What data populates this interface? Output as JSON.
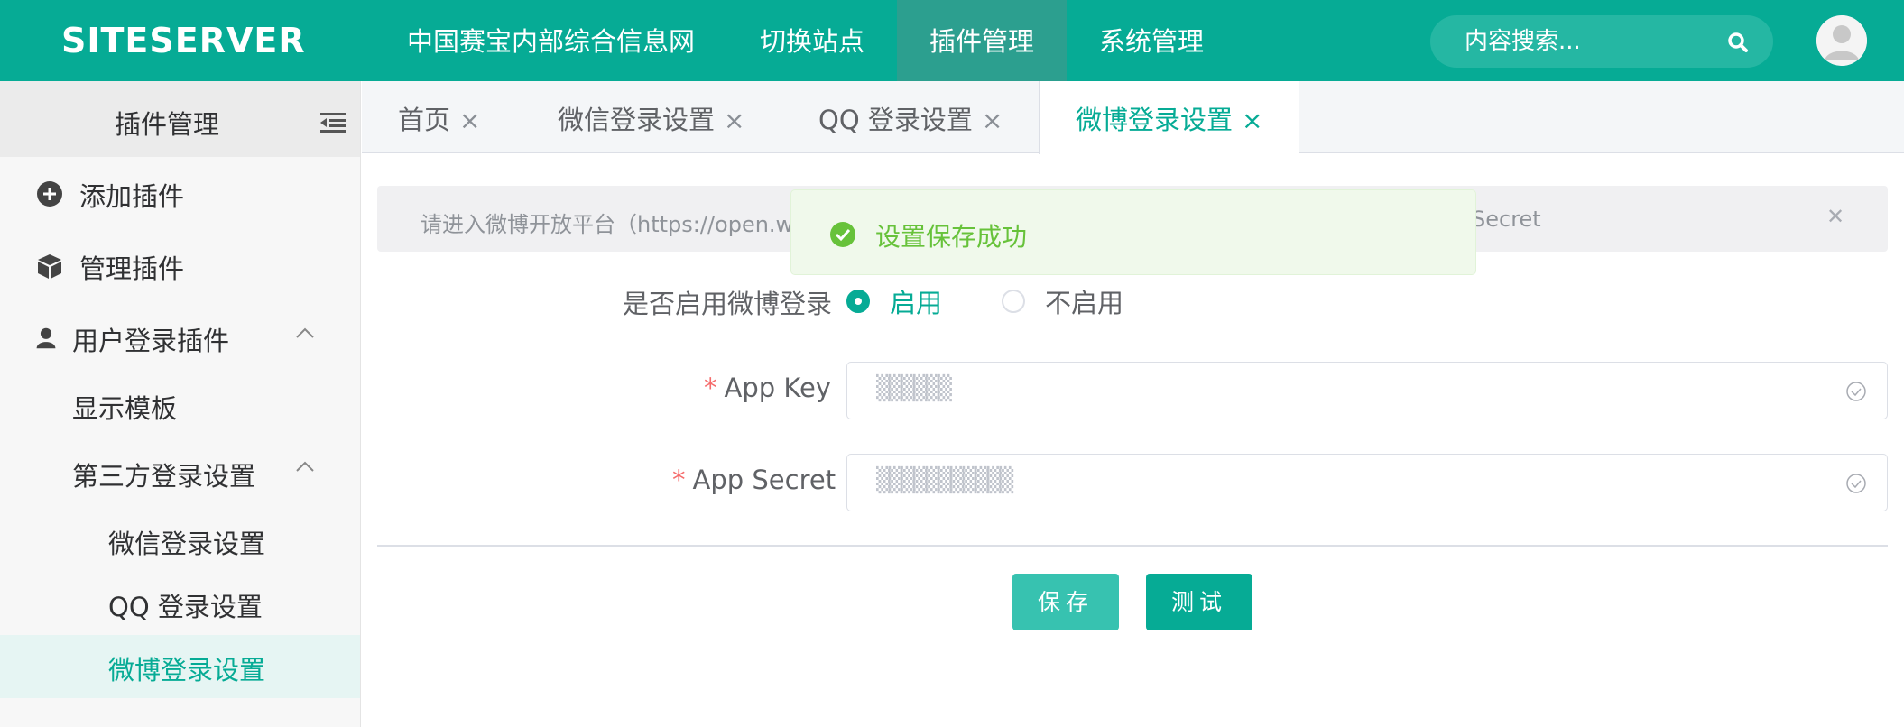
{
  "header": {
    "logo": "SITESERVER",
    "nav": [
      "中国赛宝内部综合信息网",
      "切换站点",
      "插件管理",
      "系统管理"
    ],
    "search_placeholder": "内容搜索...",
    "colors": {
      "primary": "#06ab95",
      "nav_active": "#2c9f8f"
    }
  },
  "sidebar": {
    "title": "插件管理",
    "items": [
      {
        "label": "添加插件",
        "icon": "plus-circle-icon"
      },
      {
        "label": "管理插件",
        "icon": "cube-icon"
      },
      {
        "label": "用户登录插件",
        "icon": "user-icon"
      },
      {
        "label": "显示模板"
      },
      {
        "label": "第三方登录设置"
      },
      {
        "label": "微信登录设置"
      },
      {
        "label": "QQ 登录设置"
      },
      {
        "label": "微博登录设置"
      }
    ]
  },
  "tabs": [
    "首页",
    "微信登录设置",
    "QQ 登录设置",
    "微博登录设置"
  ],
  "alert": {
    "text": "请进入微博开放平台（https://open.w",
    "text_end": "Secret"
  },
  "toast": {
    "text": "设置保存成功",
    "color": "#67c23a"
  },
  "form": {
    "enable_label": "是否启用微博登录",
    "enable_option": "启用",
    "disable_option": "不启用",
    "app_key_label": "App Key",
    "app_key_value": "▒▒▒▒▒▒",
    "app_secret_label": "App Secret",
    "app_secret_value": "▒▒▒▒▒▒▒▒▒▒▒",
    "required_mark": "*"
  },
  "buttons": {
    "save": "保存",
    "test": "测试"
  }
}
